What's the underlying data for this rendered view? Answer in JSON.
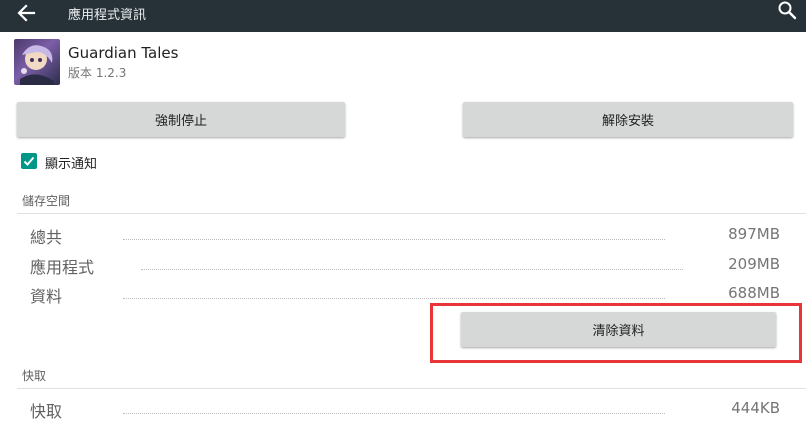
{
  "topbar": {
    "title": "應用程式資訊",
    "back_icon": "arrow-back-icon",
    "search_icon": "search-icon",
    "background": "#263238"
  },
  "app": {
    "name": "Guardian Tales",
    "version": "版本 1.2.3",
    "icon": "app-icon"
  },
  "actions": {
    "force_stop": "強制停止",
    "uninstall": "解除安裝"
  },
  "notifications": {
    "label": "顯示通知",
    "checked": true,
    "checkbox_color": "#009688"
  },
  "storage": {
    "header": "儲存空間",
    "rows": [
      {
        "label": "總共",
        "value": "897MB"
      },
      {
        "label": "應用程式",
        "value": "209MB"
      },
      {
        "label": "資料",
        "value": "688MB"
      }
    ],
    "clear_data": "清除資料"
  },
  "cache": {
    "header": "快取",
    "rows": [
      {
        "label": "快取",
        "value": "444KB"
      }
    ]
  },
  "highlight_color": "#e8353a"
}
